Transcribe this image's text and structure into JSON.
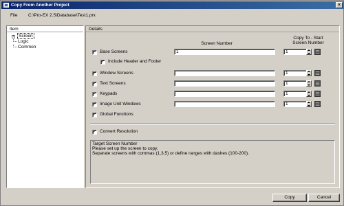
{
  "window": {
    "title": "Copy From Another Project"
  },
  "file": {
    "label": "File",
    "path": "C:\\Pro-EX 2.5\\Database\\Test1.prx"
  },
  "item_panel": {
    "header": "Item",
    "tree": [
      {
        "label": "Screen",
        "expander": "+",
        "selected": true
      },
      {
        "label": "Logic"
      },
      {
        "label": "Common"
      }
    ]
  },
  "details": {
    "header": "Details",
    "col_screen_number": "Screen Number",
    "col_copy_to_line1": "Copy To - Start",
    "col_copy_to_line2": "Screen Number",
    "base_screens": {
      "label": "Base Screens",
      "checked": true,
      "screen_number": "1",
      "copy_to": "1"
    },
    "include_header_footer": {
      "label": "Include Header and Footer",
      "checked": true
    },
    "window_screens": {
      "label": "Window Screens",
      "checked": true,
      "screen_number": "",
      "copy_to": "1"
    },
    "text_screens": {
      "label": "Text Screens",
      "checked": true,
      "screen_number": "",
      "copy_to": "1"
    },
    "keypads": {
      "label": "Keypads",
      "checked": true,
      "screen_number": "",
      "copy_to": "1"
    },
    "image_unit_windows": {
      "label": "Image Unit Windows",
      "checked": true,
      "screen_number": "",
      "copy_to": "1"
    },
    "global_functions": {
      "label": "Global Functions",
      "checked": true
    },
    "convert_resolution": {
      "label": "Convert Resolution",
      "checked": true
    },
    "info": {
      "line1": "Target Screen Number",
      "line2": "Please set up the screen to copy.",
      "line3": "Separate screens with commas (1,3,5) or define ranges with dashes (100-200)."
    }
  },
  "buttons": {
    "copy": "Copy",
    "cancel": "Cancel"
  },
  "check_mark": "✓",
  "colors": {
    "titlebar_start": "#0a246a",
    "titlebar_end": "#3a6ea5",
    "face": "#d4d0c8"
  }
}
